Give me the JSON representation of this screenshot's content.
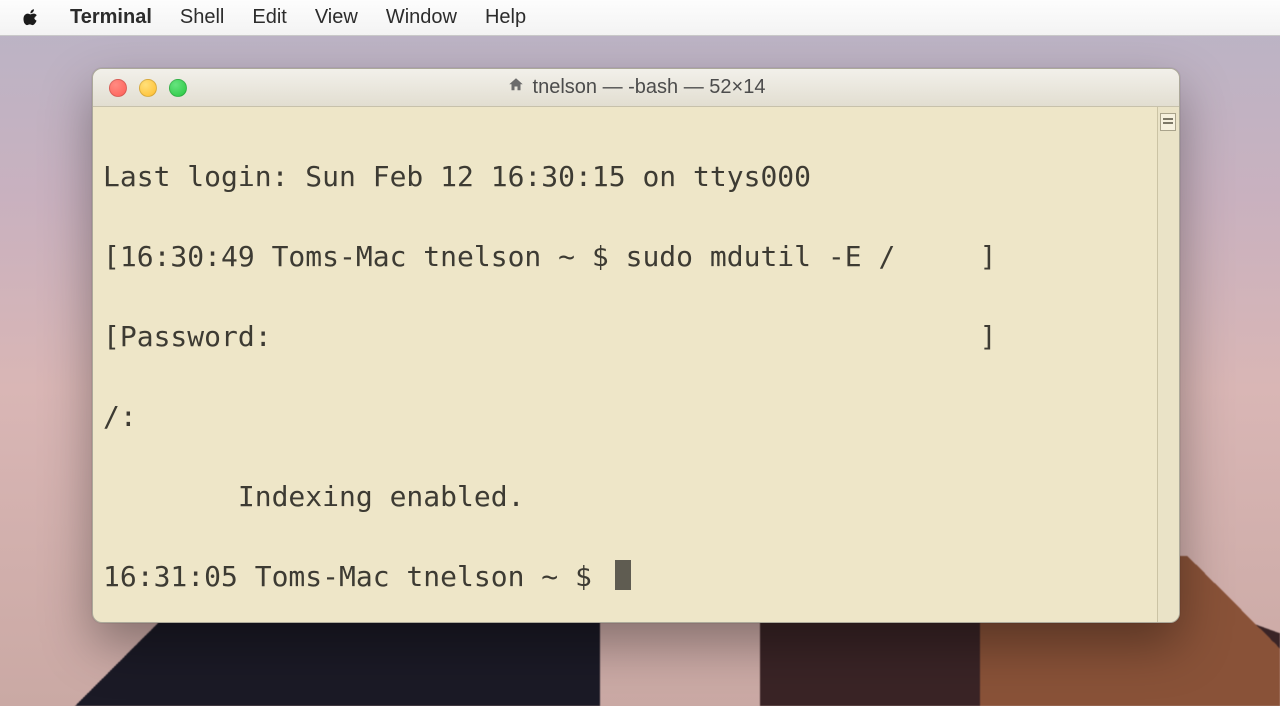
{
  "menubar": {
    "app_name": "Terminal",
    "items": [
      "Shell",
      "Edit",
      "View",
      "Window",
      "Help"
    ]
  },
  "window": {
    "title": "tnelson — -bash — 52×14",
    "traffic": {
      "close": "close",
      "min": "minimize",
      "max": "zoom"
    }
  },
  "terminal": {
    "lines": [
      "Last login: Sun Feb 12 16:30:15 on ttys000",
      "[16:30:49 Toms-Mac tnelson ~ $ sudo mdutil -E /     ]",
      "[Password:                                          ]",
      "/:",
      "\tIndexing enabled. ",
      "16:31:05 Toms-Mac tnelson ~ $ "
    ]
  }
}
